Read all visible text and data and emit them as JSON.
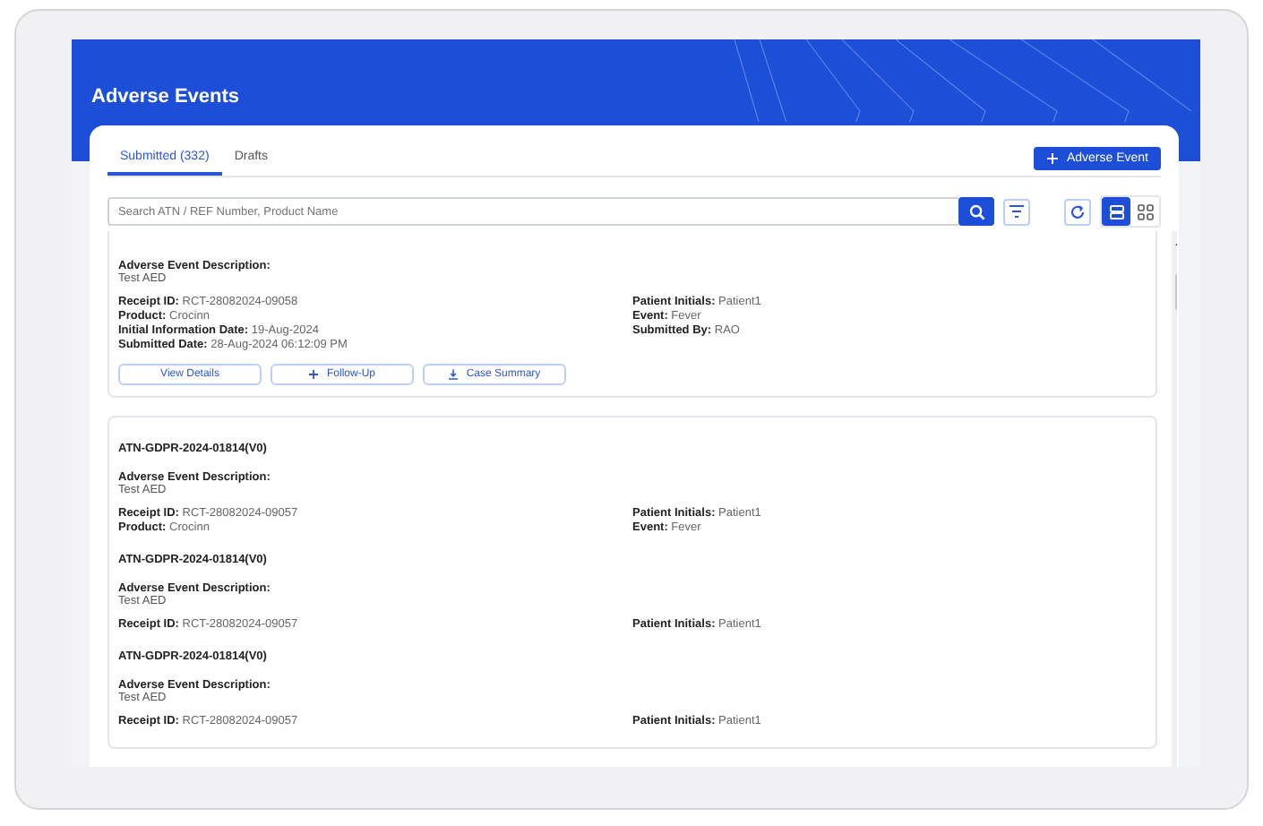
{
  "header": {
    "title": "Adverse Events"
  },
  "tabs": [
    {
      "label": "Submitted (332)",
      "selected": true
    },
    {
      "label": "Drafts",
      "selected": false
    }
  ],
  "add_button": {
    "label": "Adverse Event"
  },
  "search": {
    "placeholder": "Search ATN / REF Number, Product Name"
  },
  "view_toggle": [
    {
      "kind": "list",
      "selected": true
    },
    {
      "kind": "grid",
      "selected": false
    }
  ],
  "cards": [
    {
      "sections": [
        {
          "description_label": "Adverse Event Description:",
          "description": "Test AED",
          "left": [
            {
              "label": "Receipt ID:",
              "value": "RCT-28082024-09058"
            },
            {
              "label": "Product:",
              "value": "Crocinn"
            },
            {
              "label": "Initial Information Date:",
              "value": "19-Aug-2024"
            },
            {
              "label": "Submitted Date:",
              "value": "28-Aug-2024 06:12:09 PM"
            }
          ],
          "right": [
            {
              "label": "Patient Initials:",
              "value": "Patient1"
            },
            {
              "label": "Event:",
              "value": "Fever"
            },
            {
              "label": "Submitted By:",
              "value": "RAO"
            }
          ]
        }
      ],
      "buttons": [
        {
          "kind": "view",
          "label": "View Details"
        },
        {
          "kind": "add",
          "label": "Follow-Up"
        },
        {
          "kind": "download",
          "label": "Case Summary"
        }
      ]
    },
    {
      "sections": [
        {
          "title": "ATN-GDPR-2024-01814(V0)",
          "description_label": "Adverse Event Description:",
          "description": "Test AED",
          "left": [
            {
              "label": "Receipt ID:",
              "value": "RCT-28082024-09057"
            },
            {
              "label": "Product:",
              "value": "Crocinn"
            }
          ],
          "right": [
            {
              "label": "Patient Initials:",
              "value": "Patient1"
            },
            {
              "label": "Event:",
              "value": "Fever"
            }
          ]
        },
        {
          "title": "ATN-GDPR-2024-01814(V0)",
          "description_label": "Adverse Event Description:",
          "description": "Test AED",
          "left": [
            {
              "label": "Receipt ID:",
              "value": "RCT-28082024-09057"
            }
          ],
          "right": [
            {
              "label": "Patient Initials:",
              "value": "Patient1"
            }
          ]
        },
        {
          "title": "ATN-GDPR-2024-01814(V0)",
          "description_label": "Adverse Event Description:",
          "description": "Test AED",
          "left": [
            {
              "label": "Receipt ID:",
              "value": "RCT-28082024-09057"
            }
          ],
          "right": [
            {
              "label": "Patient Initials:",
              "value": "Patient1"
            }
          ]
        }
      ]
    }
  ]
}
